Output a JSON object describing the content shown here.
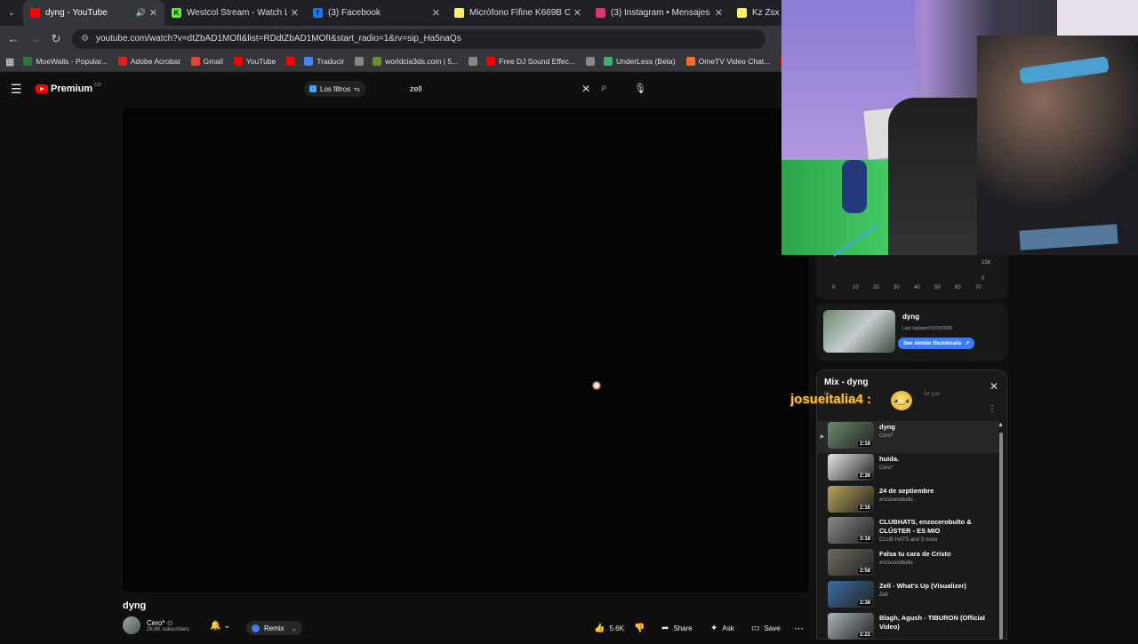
{
  "browser": {
    "tabs": [
      {
        "title": "dyng - YouTube",
        "fav_color": "#ff0000",
        "fav_glyph": "",
        "active": true,
        "audio": true
      },
      {
        "title": "Westcol Stream - Watch Live on",
        "fav_color": "#53fc18",
        "fav_glyph": "K",
        "active": false
      },
      {
        "title": "(3) Facebook",
        "fav_color": "#1877f2",
        "fav_glyph": "f",
        "active": false
      },
      {
        "title": "Micrófono Fifine K669B Conden",
        "fav_color": "#fff159",
        "fav_glyph": "",
        "active": false
      },
      {
        "title": "(3) Instagram • Mensajes",
        "fav_color": "#e1306c",
        "fav_glyph": "",
        "active": false
      },
      {
        "title": "Kz Zsx Term",
        "fav_color": "#fff159",
        "fav_glyph": "",
        "active": false
      }
    ],
    "url": "youtube.com/watch?v=dtZbAD1MOfI&list=RDdtZbAD1MOfI&start_radio=1&rv=sip_Ha5naQs",
    "bookmarks": [
      {
        "label": "MoeWalls - Popular...",
        "color": "#2a7b3b"
      },
      {
        "label": "Adobe Acrobat",
        "color": "#e0201a"
      },
      {
        "label": "Gmail",
        "color": "#ea4335"
      },
      {
        "label": "YouTube",
        "color": "#ff0000"
      },
      {
        "label": "",
        "color": "#ff0000"
      },
      {
        "label": "Traducir",
        "color": "#4285f4"
      },
      {
        "label": "",
        "color": "#888888"
      },
      {
        "label": "worldcia3ds.com | 5...",
        "color": "#6b8e23"
      },
      {
        "label": "",
        "color": "#888888"
      },
      {
        "label": "Free DJ Sound Effec...",
        "color": "#ff0000"
      },
      {
        "label": "",
        "color": "#888888"
      },
      {
        "label": "UnderLess (Beta)",
        "color": "#3cb371"
      },
      {
        "label": "OmeTV Video Chat...",
        "color": "#ff6a2a"
      },
      {
        "label": "Ch",
        "color": "#ff0000"
      }
    ]
  },
  "youtube": {
    "logo_text": "Premium",
    "logo_badge": "CO",
    "filters_label": "Los filtros",
    "search_value": "zell",
    "video_title": "dyng",
    "channel_name": "Cero*",
    "channel_subs": "28.6K subscribers",
    "remix_label": "Remix",
    "like_count": "5.6K",
    "share_label": "Share",
    "ask_label": "Ask",
    "save_label": "Save"
  },
  "stats_panel": {
    "x_ticks": [
      "0",
      "10",
      "20",
      "30",
      "40",
      "50",
      "60",
      "70"
    ],
    "y_ticks": [
      "15K",
      "0"
    ],
    "similar_name": "dyng",
    "similar_updated": "Last Updated 03/19/2026",
    "similar_button": "See similar thumbnails"
  },
  "mix": {
    "title": "Mix - dyng",
    "subtitle": "Mi",
    "subtitle_right": "for you",
    "items": [
      {
        "title": "dyng",
        "artist": "Cero*",
        "duration": "2:18",
        "thumb": "#6c8a6a",
        "current": true
      },
      {
        "title": "huida.",
        "artist": "Cero*",
        "duration": "2:36",
        "thumb": "#e8e4e4",
        "current": false
      },
      {
        "title": "24 de septiembre",
        "artist": "enzocerobulto",
        "duration": "2:16",
        "thumb": "#b9a35a",
        "current": false
      },
      {
        "title": "CLUBHATS, enzocerobulto & CLÚSTER - ES MIO",
        "artist": "CLUB HATS and 3 more",
        "duration": "3:18",
        "thumb": "#8a8a8a",
        "current": false
      },
      {
        "title": "Falsa tu cara de Cristo",
        "artist": "enzocerobulto",
        "duration": "2:58",
        "thumb": "#6e6a5e",
        "current": false
      },
      {
        "title": "Zell - What's Up (Visualizer)",
        "artist": "Zell",
        "duration": "2:38",
        "thumb": "#3b6ea5",
        "current": false
      },
      {
        "title": "Blagh, Agush - TIBURON (Official Video)",
        "artist": "",
        "duration": "2:22",
        "thumb": "#a9b6bd",
        "current": false
      }
    ]
  },
  "chat_overlay": {
    "username": "josueitalia4 :"
  }
}
